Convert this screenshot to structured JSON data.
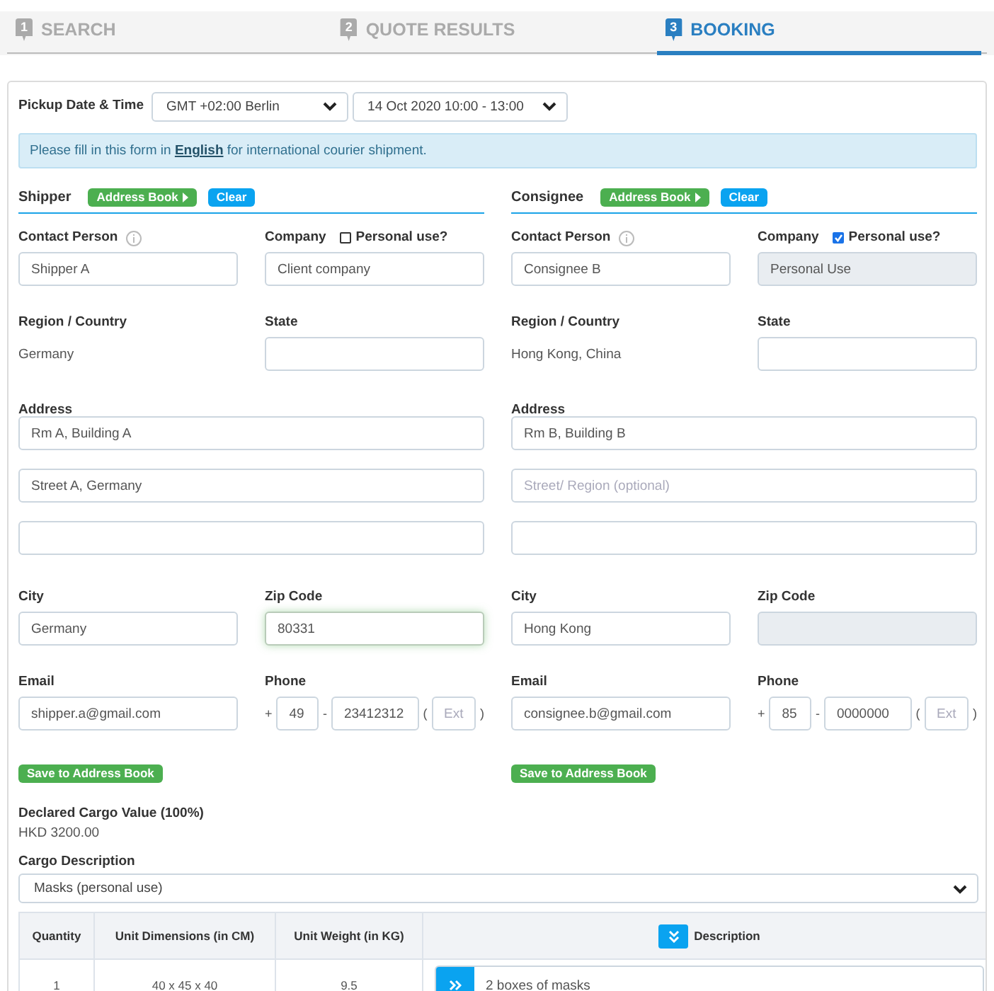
{
  "steps": [
    {
      "number": "1",
      "label": "SEARCH",
      "selected": false
    },
    {
      "number": "2",
      "label": "QUOTE RESULTS",
      "selected": false
    },
    {
      "number": "3",
      "label": "BOOKING",
      "selected": true
    }
  ],
  "pickup": {
    "label": "Pickup Date & Time",
    "timezone": "GMT +02:00 Berlin",
    "slot": "14 Oct 2020 10:00 - 13:00"
  },
  "notice": {
    "before": "Please fill in this form in",
    "link": "English",
    "after": "for international courier shipment."
  },
  "parties": [
    {
      "title": "Shipper",
      "address_book_button": "Address Book",
      "clear_button": "Clear",
      "contact": {
        "label": "Contact Person",
        "value": "Shipper A"
      },
      "company": {
        "label": "Company",
        "value": "Client company",
        "disabled": false,
        "personal_use": {
          "label": "Personal use?",
          "checked": false
        }
      },
      "region": {
        "label": "Region / Country",
        "value": "Germany"
      },
      "state": {
        "label": "State"
      },
      "address": {
        "label": "Address",
        "lines": [
          {
            "kind": "value",
            "text": "Rm A, Building A"
          },
          {
            "kind": "value",
            "text": "Street A, Germany"
          },
          {
            "kind": "blank"
          }
        ]
      },
      "city": {
        "label": "City",
        "value": "Germany"
      },
      "zip": {
        "label": "Zip Code",
        "value": "80331",
        "disabled": false,
        "focused": true
      },
      "email": {
        "label": "Email",
        "value": "shipper.a@gmail.com"
      },
      "phone": {
        "label": "Phone",
        "plus": "+",
        "dash": "-",
        "open": "(",
        "close": ")",
        "country_code": "49",
        "number": "23412312",
        "ext_placeholder": "Ext"
      },
      "save_button": "Save to Address Book"
    },
    {
      "title": "Consignee",
      "address_book_button": "Address Book",
      "clear_button": "Clear",
      "contact": {
        "label": "Contact Person",
        "value": "Consignee B"
      },
      "company": {
        "label": "Company",
        "value": "Personal Use",
        "disabled": true,
        "personal_use": {
          "label": "Personal use?",
          "checked": true
        }
      },
      "region": {
        "label": "Region / Country",
        "value": "Hong Kong, China"
      },
      "state": {
        "label": "State"
      },
      "address": {
        "label": "Address",
        "lines": [
          {
            "kind": "value",
            "text": "Rm B, Building B"
          },
          {
            "kind": "placeholder",
            "text": "Street/ Region (optional)"
          },
          {
            "kind": "blank"
          }
        ]
      },
      "city": {
        "label": "City",
        "value": "Hong Kong"
      },
      "zip": {
        "label": "Zip Code",
        "disabled": true,
        "focused": false
      },
      "email": {
        "label": "Email",
        "value": "consignee.b@gmail.com"
      },
      "phone": {
        "label": "Phone",
        "plus": "+",
        "dash": "-",
        "open": "(",
        "close": ")",
        "country_code": "85",
        "number": "0000000",
        "ext_placeholder": "Ext"
      },
      "save_button": "Save to Address Book"
    }
  ],
  "declared_value": {
    "label": "Declared Cargo Value (100%)",
    "value": "HKD 3200.00"
  },
  "cargo_description": {
    "label": "Cargo Description",
    "value": "Masks (personal use)"
  },
  "cargo_table": {
    "columns": [
      "Quantity",
      "Unit Dimensions (in CM)",
      "Unit Weight (in KG)",
      "Description"
    ],
    "rows": [
      {
        "quantity": "1",
        "dimensions": "40 x 45 x 40",
        "weight": "9.5",
        "description": "2 boxes of masks"
      }
    ]
  }
}
